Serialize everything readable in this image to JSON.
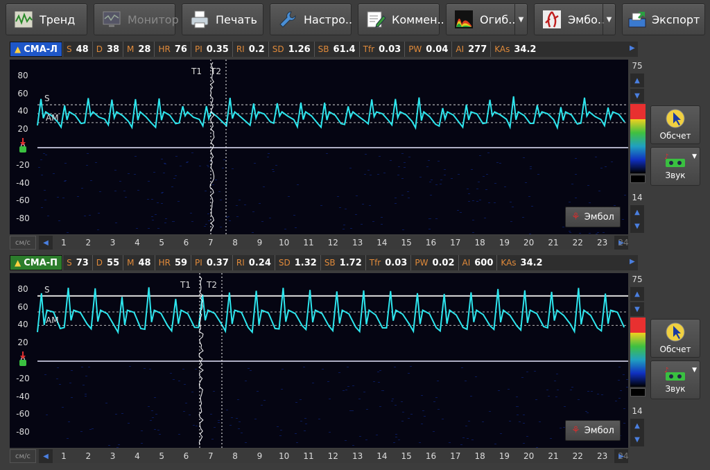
{
  "toolbar": {
    "trend": "Тренд",
    "monitor": "Монитор",
    "print": "Печать",
    "settings": "Настро..",
    "comment": "Коммен..",
    "envelope": "Огиб..",
    "embol": "Эмбо..",
    "export": "Экспорт"
  },
  "panels": [
    {
      "channel": "СМА-Л",
      "channel_color": "#1f57c8",
      "params": [
        {
          "k": "S",
          "v": "48"
        },
        {
          "k": "D",
          "v": "38"
        },
        {
          "k": "M",
          "v": "28"
        },
        {
          "k": "HR",
          "v": "76"
        },
        {
          "k": "PI",
          "v": "0.35"
        },
        {
          "k": "RI",
          "v": "0.2"
        },
        {
          "k": "SD",
          "v": "1.26"
        },
        {
          "k": "SB",
          "v": "61.4"
        },
        {
          "k": "Tfr",
          "v": "0.03"
        },
        {
          "k": "PW",
          "v": "0.04"
        },
        {
          "k": "AI",
          "v": "277"
        },
        {
          "k": "KAs",
          "v": "34.2"
        }
      ],
      "scale_top": "75",
      "scale_bottom": "14",
      "embol_button": "Эмбол",
      "obsch_label": "Обсчет",
      "sound_label": "Звук",
      "t1": "T1",
      "t2": "T2",
      "s_label": "S",
      "am_label": "AM",
      "unit": "см/с",
      "last_tick": "24"
    },
    {
      "channel": "СМА-П",
      "channel_color": "#2c7d2c",
      "params": [
        {
          "k": "S",
          "v": "73"
        },
        {
          "k": "D",
          "v": "55"
        },
        {
          "k": "M",
          "v": "48"
        },
        {
          "k": "HR",
          "v": "59"
        },
        {
          "k": "PI",
          "v": "0.37"
        },
        {
          "k": "RI",
          "v": "0.24"
        },
        {
          "k": "SD",
          "v": "1.32"
        },
        {
          "k": "SB",
          "v": "1.72"
        },
        {
          "k": "Tfr",
          "v": "0.03"
        },
        {
          "k": "PW",
          "v": "0.02"
        },
        {
          "k": "AI",
          "v": "600"
        },
        {
          "k": "KAs",
          "v": "34.2"
        }
      ],
      "scale_top": "75",
      "scale_bottom": "14",
      "embol_button": "Эмбол",
      "obsch_label": "Обсчет",
      "sound_label": "Звук",
      "t1": "T1",
      "t2": "T2",
      "s_label": "S",
      "am_label": "AM",
      "unit": "см/с",
      "last_tick": "24"
    }
  ],
  "y_ticks": [
    "80",
    "60",
    "40",
    "20",
    "0",
    "-20",
    "-40",
    "-60",
    "-80"
  ],
  "x_ticks": [
    "1",
    "2",
    "3",
    "4",
    "5",
    "6",
    "7",
    "8",
    "9",
    "10",
    "11",
    "12",
    "13",
    "14",
    "15",
    "16",
    "17",
    "18",
    "19",
    "20",
    "21",
    "22",
    "23"
  ],
  "colors": {
    "trace": "#2de6ee",
    "accent_blue": "#1f57c8",
    "accent_green": "#2c7d2c",
    "param_key": "#e08a3a"
  }
}
